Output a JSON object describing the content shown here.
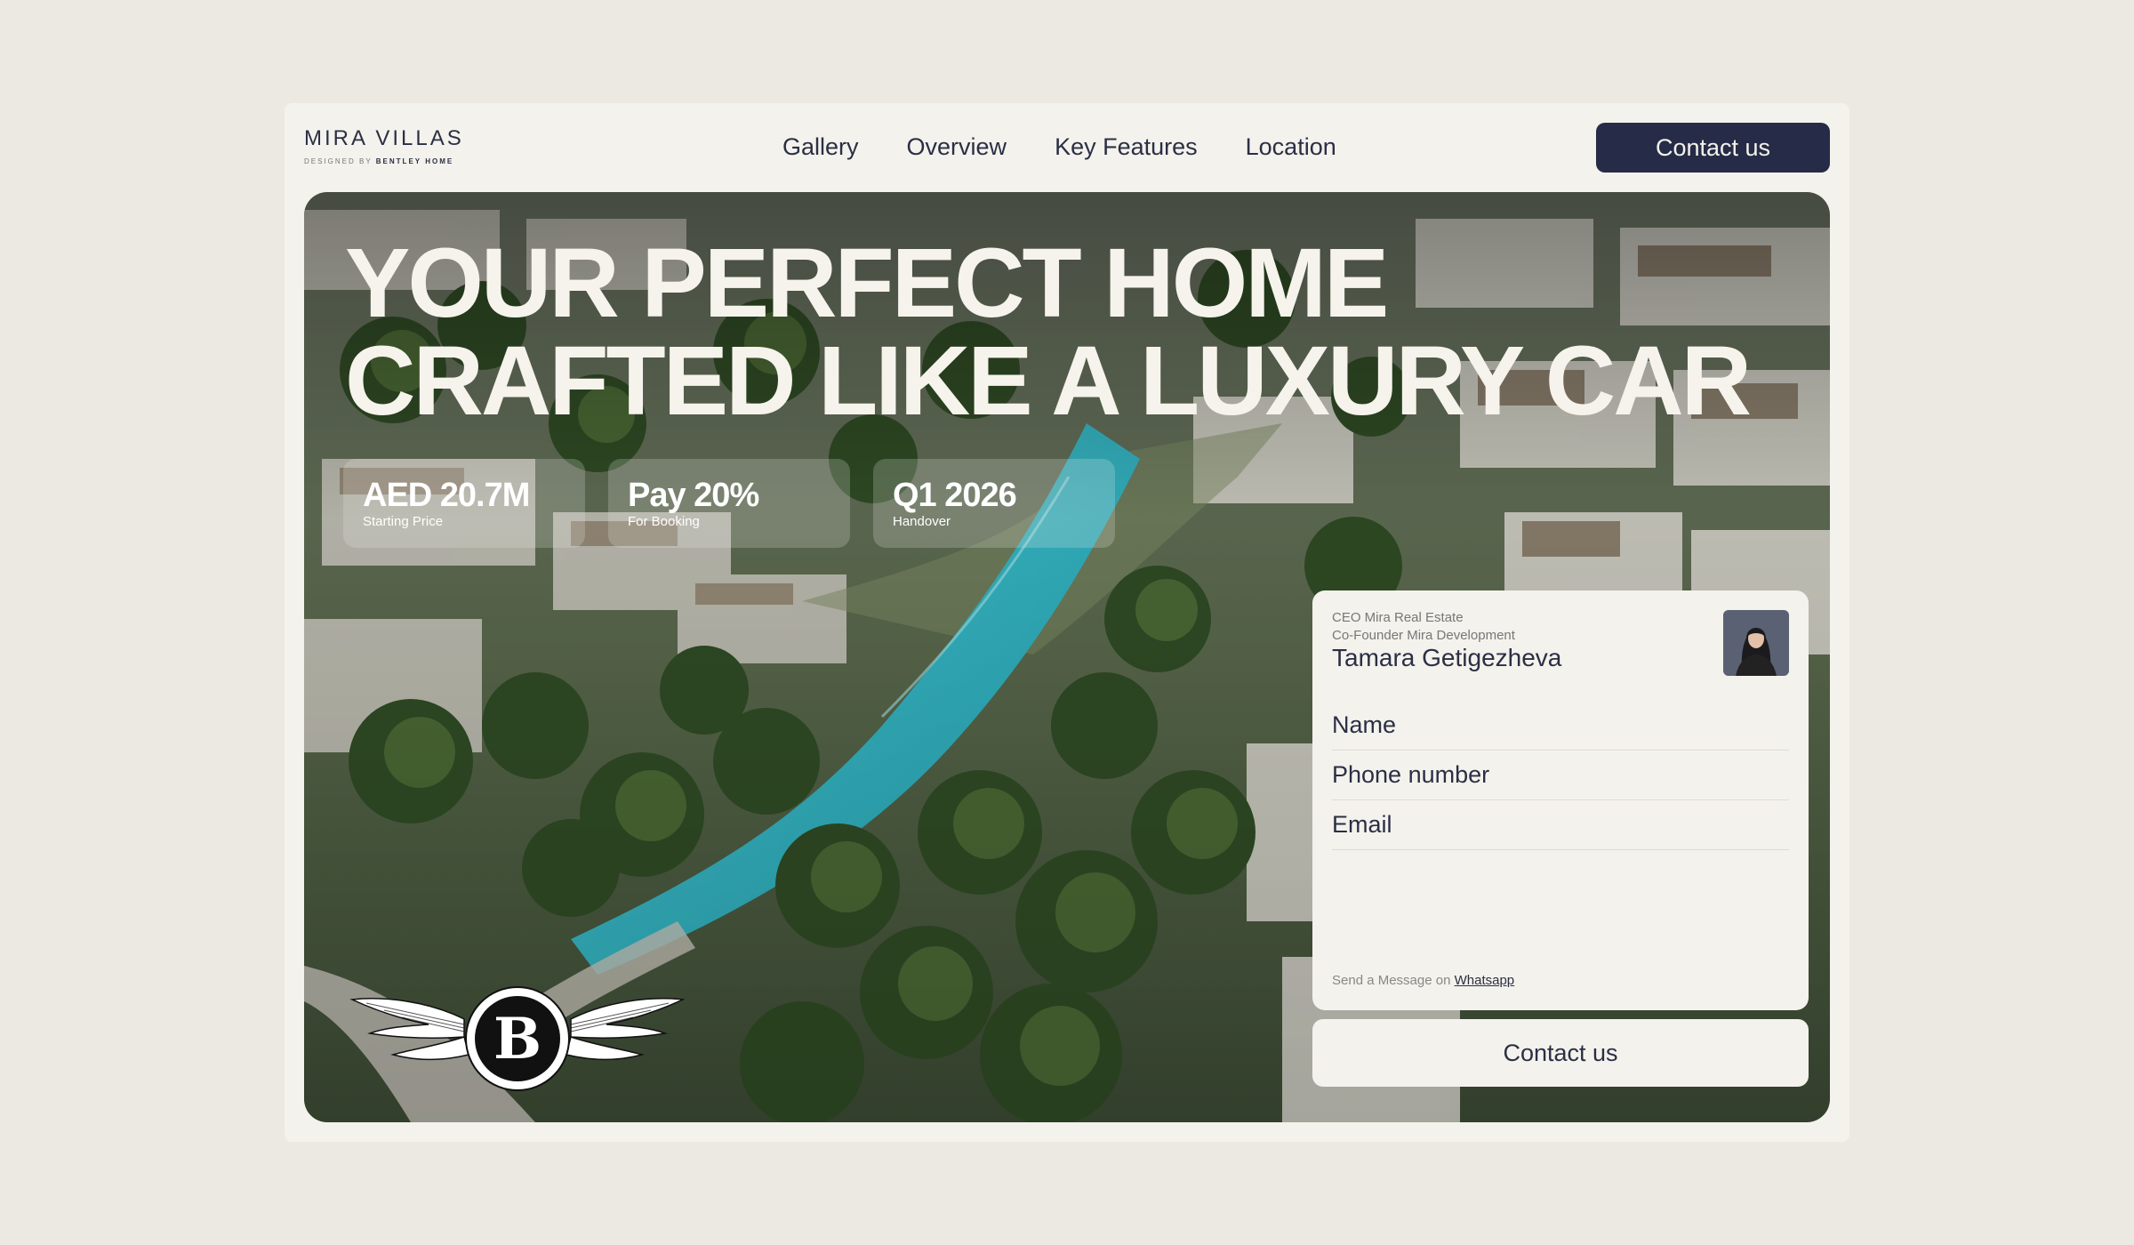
{
  "brand": {
    "name": "MIRA VILLAS",
    "tagline_prefix": "DESIGNED BY",
    "tagline_brand": "BENTLEY HOME"
  },
  "nav": {
    "items": [
      {
        "label": "Gallery"
      },
      {
        "label": "Overview"
      },
      {
        "label": "Key Features"
      },
      {
        "label": "Location"
      }
    ]
  },
  "header": {
    "contact_label": "Contact us"
  },
  "hero": {
    "headline_line1": "YOUR PERFECT HOME",
    "headline_line2": "CRAFTED LIKE A LUXURY CAR",
    "stats": [
      {
        "value": "AED 20.7M",
        "label": "Starting Price"
      },
      {
        "value": "Pay 20%",
        "label": "For Booking"
      },
      {
        "value": "Q1 2026",
        "label": "Handover"
      }
    ],
    "emblem_letter": "B"
  },
  "form": {
    "person_role1": "CEO Mira Real Estate",
    "person_role2": "Co-Founder Mira Development",
    "person_name": "Tamara Getigezheva",
    "fields": [
      {
        "placeholder": "Name"
      },
      {
        "placeholder": "Phone number"
      },
      {
        "placeholder": "Email"
      }
    ],
    "whatsapp_prefix": "Send a Message on",
    "whatsapp_link": "Whatsapp",
    "submit_label": "Contact us"
  },
  "colors": {
    "page_bg": "#ece9e3",
    "card_bg": "#f4f2ec",
    "primary": "#262c47",
    "water": "#2fb7c4",
    "foliage": "#3f5a2e"
  }
}
